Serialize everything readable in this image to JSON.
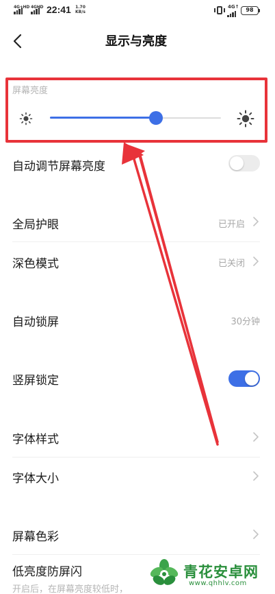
{
  "status_bar": {
    "sim1_network": "4G+HD",
    "sim2_network": "4GHD",
    "time": "22:41",
    "speed_value": "1.70",
    "speed_unit": "KB/s",
    "sim3_network": "4G↑",
    "battery": "98",
    "icons": [
      "signal-icon",
      "vibrate-icon",
      "battery-icon"
    ]
  },
  "header": {
    "back_icon": "chevron-left-icon",
    "title": "显示与亮度"
  },
  "brightness": {
    "label": "屏幕亮度",
    "level_fraction": 0.62,
    "min_icon": "sun-small-icon",
    "max_icon": "sun-large-icon",
    "accent_color": "#3d6fe6",
    "highlight_color": "#e8333a"
  },
  "rows": {
    "auto_brightness": {
      "label": "自动调节屏幕亮度",
      "enabled": false
    },
    "eye_care": {
      "label": "全局护眼",
      "value": "已开启"
    },
    "dark_mode": {
      "label": "深色模式",
      "value": "已关闭"
    },
    "auto_lock": {
      "label": "自动锁屏",
      "value": "30分钟"
    },
    "portrait_lock": {
      "label": "竖屏锁定",
      "enabled": true
    },
    "font_style": {
      "label": "字体样式"
    },
    "font_size": {
      "label": "字体大小"
    },
    "screen_color": {
      "label": "屏幕色彩"
    },
    "low_brightness_flicker": {
      "label": "低亮度防屏闪",
      "sub": "开启后，在屏幕亮度较低时，"
    }
  },
  "watermark": {
    "name": "青花安卓网",
    "url": "www.qhhlv.com",
    "color": "#2a8f3c"
  }
}
